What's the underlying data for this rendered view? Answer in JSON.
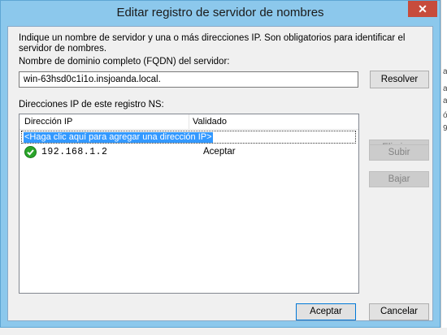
{
  "window": {
    "title": "Editar registro de servidor de nombres",
    "close_glyph": "✕"
  },
  "intro_text": "Indique un nombre de servidor y una o más direcciones IP. Son obligatorios para identificar el servidor de nombres.",
  "fqdn": {
    "label": "Nombre de dominio completo (FQDN) del servidor:",
    "value": "win-63hsd0c1i1o.insjoanda.local.",
    "resolve_label": "Resolver"
  },
  "ip_section": {
    "label": "Direcciones IP de este registro NS:",
    "columns": [
      "Dirección IP",
      "Validado"
    ],
    "add_row_text": "<Haga clic aquí para agregar una dirección IP>",
    "rows": [
      {
        "ip": "192.168.1.2",
        "status": "Aceptar",
        "icon": "check-circle-green"
      }
    ]
  },
  "side_buttons": {
    "delete_label": "Eliminar",
    "up_label": "Subir",
    "down_label": "Bajar"
  },
  "footer": {
    "accept_label": "Aceptar",
    "cancel_label": "Cancelar"
  },
  "background": {
    "glyphs": [
      "a",
      "a",
      "a",
      "ó",
      "9"
    ]
  },
  "colors": {
    "title_bar": "#8cc8ec",
    "close_button": "#c74c3c",
    "selection": "#3399ff",
    "check": "#2aa52a"
  }
}
